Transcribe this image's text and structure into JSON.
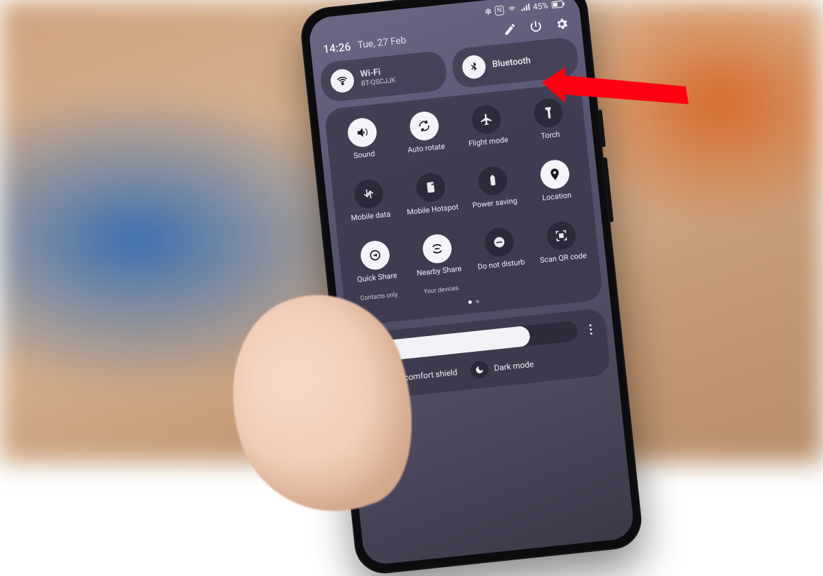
{
  "status": {
    "battery_pct": "45%",
    "bt_glyph": "✻",
    "nfc_glyph": "N",
    "wifi_glyph": "▲",
    "signal_glyph": "▮"
  },
  "header": {
    "time": "14:26",
    "date": "Tue, 27 Feb"
  },
  "conn": {
    "wifi": {
      "title": "Wi-Fi",
      "subtitle": "BT-QSCJJK"
    },
    "bt": {
      "title": "Bluetooth"
    }
  },
  "tiles": [
    {
      "id": "sound",
      "label": "Sound",
      "on": true
    },
    {
      "id": "autorotate",
      "label": "Auto rotate",
      "on": true
    },
    {
      "id": "flight",
      "label": "Flight mode",
      "on": false
    },
    {
      "id": "torch",
      "label": "Torch",
      "on": false
    },
    {
      "id": "mobiledata",
      "label": "Mobile data",
      "on": false
    },
    {
      "id": "hotspot",
      "label": "Mobile Hotspot",
      "on": false
    },
    {
      "id": "powersave",
      "label": "Power saving",
      "on": false
    },
    {
      "id": "location",
      "label": "Location",
      "on": true
    },
    {
      "id": "quickshare",
      "label": "Quick Share",
      "sub": "Contacts only",
      "on": true
    },
    {
      "id": "nearbyshare",
      "label": "Nearby Share",
      "sub": "Your devices",
      "on": true
    },
    {
      "id": "dnd",
      "label": "Do not disturb",
      "on": false
    },
    {
      "id": "scanqr",
      "label": "Scan QR code",
      "on": false
    }
  ],
  "brightness": {
    "percent": 78
  },
  "modes": {
    "eye": "Eye comfort shield",
    "dark": "Dark mode"
  },
  "arrow_target": "power-button"
}
